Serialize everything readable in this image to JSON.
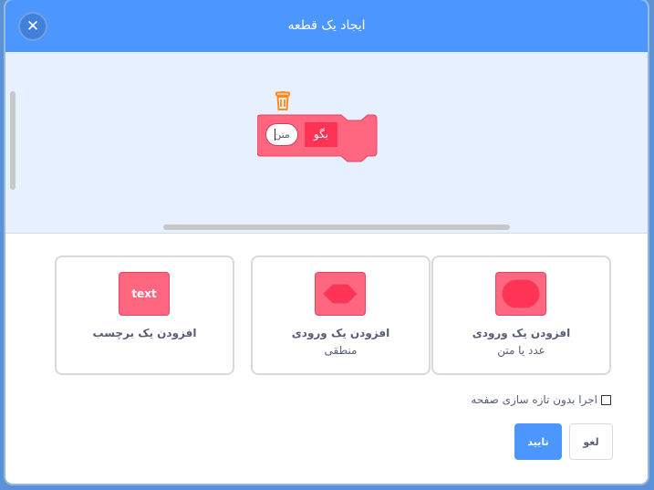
{
  "dialog": {
    "title": "ایجاد یک قطعه"
  },
  "block": {
    "say_label": "بگو",
    "input_value": "متن"
  },
  "options": [
    {
      "title": "افزودن یک ورودی",
      "subtitle": "عدد یا متن",
      "icon": "round-input-icon"
    },
    {
      "title": "افزودن یک ورودی",
      "subtitle": "منطقی",
      "icon": "hexagon-input-icon"
    },
    {
      "title": "افزودن یک برچسب",
      "subtitle": "",
      "icon": "label-icon",
      "icon_text": "text"
    }
  ],
  "run_without_refresh": {
    "label": "اجرا بدون تازه سازی صفحه",
    "checked": false
  },
  "buttons": {
    "ok": "تایید",
    "cancel": "لغو"
  },
  "colors": {
    "header": "#4c97ff",
    "block": "#ff6680",
    "block_dark": "#ff3355",
    "workspace": "#e6f0ff",
    "trash": "#ff8c1a"
  }
}
